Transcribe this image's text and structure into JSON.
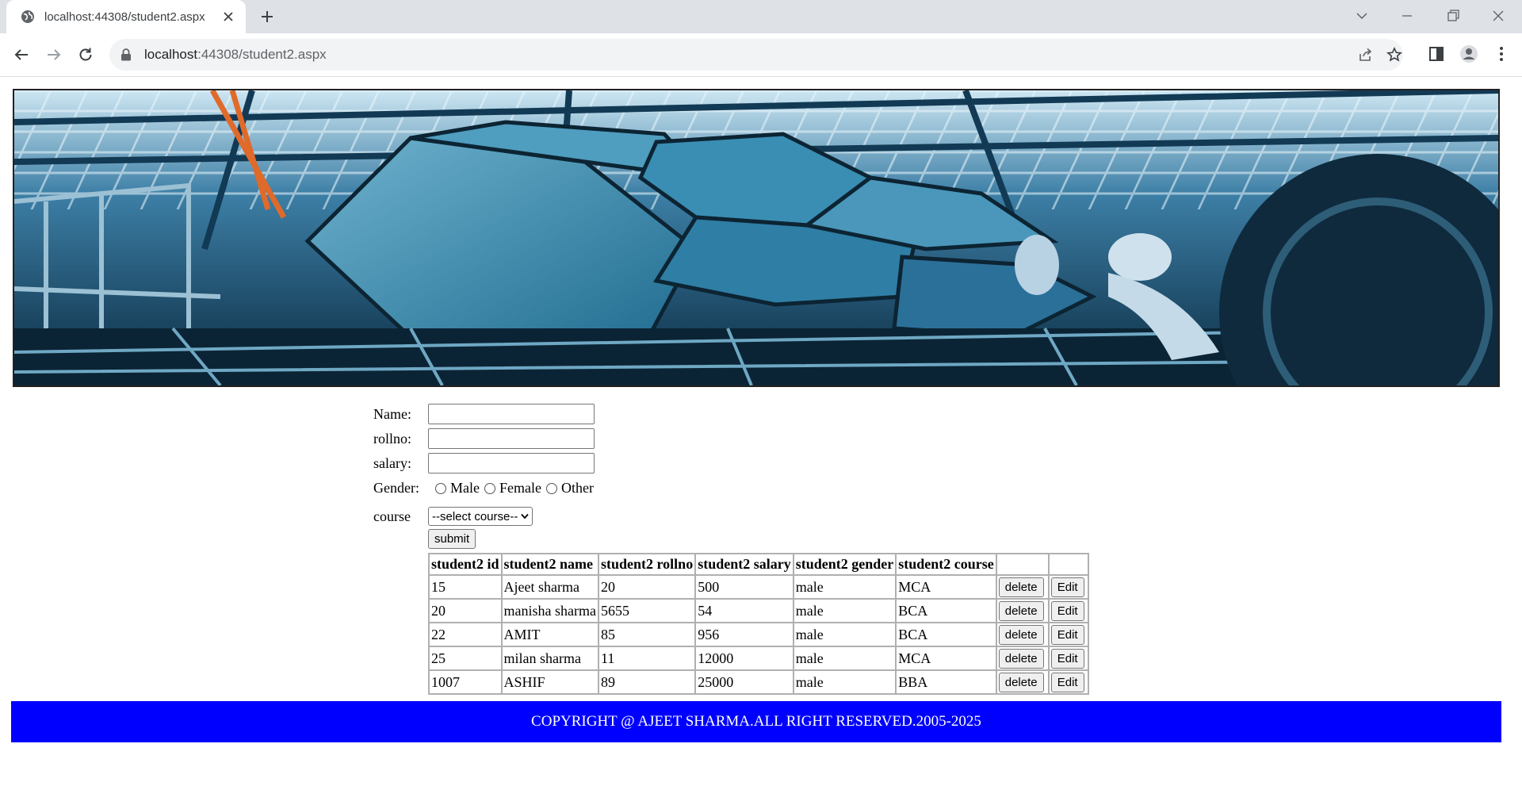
{
  "browser": {
    "tab_title": "localhost:44308/student2.aspx",
    "url_host": "localhost",
    "url_rest": ":44308/student2.aspx"
  },
  "form": {
    "name_label": "Name:",
    "rollno_label": "rollno:",
    "salary_label": "salary:",
    "gender_label": "Gender:",
    "gender_options": [
      "Male",
      "Female",
      "Other"
    ],
    "course_label": "course",
    "course_selected": "--select course--",
    "submit_label": "submit"
  },
  "table": {
    "headers": [
      "student2 id",
      "student2 name",
      "student2 rollno",
      "student2 salary",
      "student2 gender",
      "student2 course",
      "",
      ""
    ],
    "rows": [
      [
        "15",
        "Ajeet sharma",
        "20",
        "500",
        "male",
        "MCA"
      ],
      [
        "20",
        "manisha sharma",
        "5655",
        "54",
        "male",
        "BCA"
      ],
      [
        "22",
        "AMIT",
        "85",
        "956",
        "male",
        "BCA"
      ],
      [
        "25",
        "milan sharma",
        "11",
        "12000",
        "male",
        "MCA"
      ],
      [
        "1007",
        "ASHIF",
        "89",
        "25000",
        "male",
        "BBA"
      ]
    ],
    "delete_label": "delete",
    "edit_label": "Edit"
  },
  "footer": {
    "text": "COPYRIGHT @ AJEET SHARMA.ALL RIGHT RESERVED.2005-2025"
  }
}
